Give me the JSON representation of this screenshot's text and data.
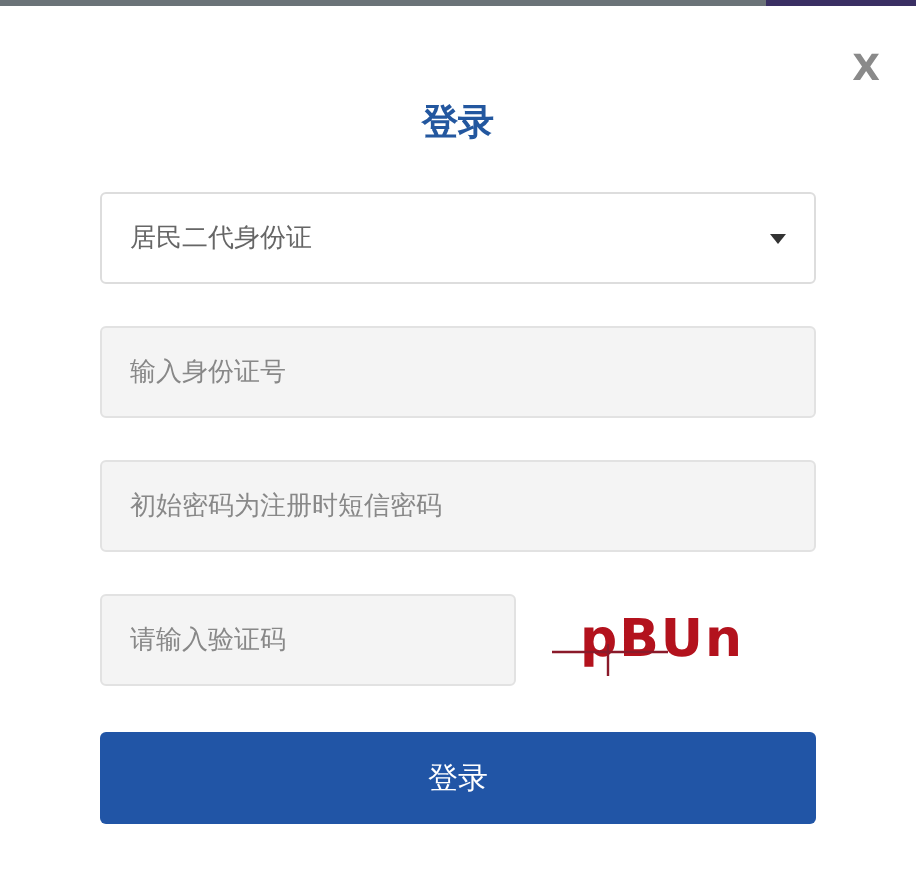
{
  "dialog": {
    "title": "登录",
    "close": "X"
  },
  "select": {
    "value": "居民二代身份证"
  },
  "fields": [
    {
      "placeholder": "输入身份证号"
    },
    {
      "placeholder": "初始密码为注册时短信密码"
    }
  ],
  "captcha": {
    "placeholder": "请输入验证码",
    "code": "pBUn"
  },
  "submit": "登录"
}
